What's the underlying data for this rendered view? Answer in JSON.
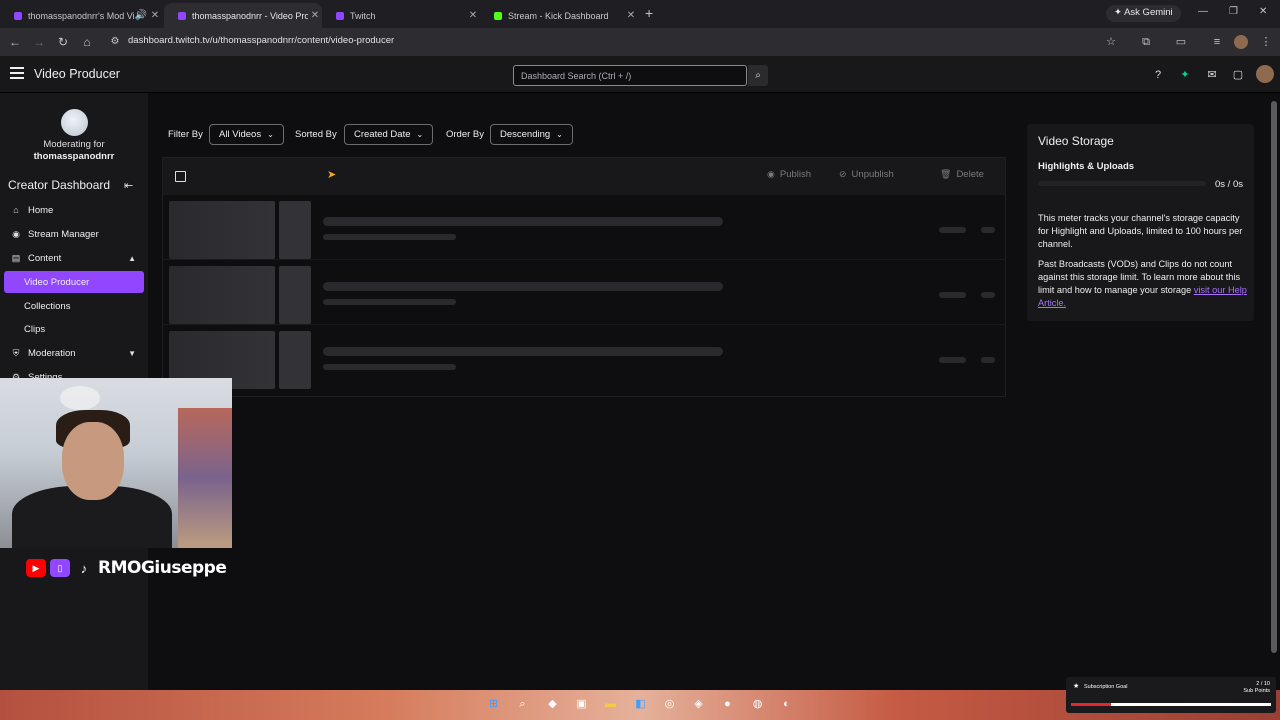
{
  "browser": {
    "tabs": [
      {
        "title": "thomasspanodnrr's Mod Vi",
        "favicon": "twitch-icon",
        "active": false
      },
      {
        "title": "thomasspanodnrr - Video Produ",
        "favicon": "twitch-icon",
        "active": true
      },
      {
        "title": "Twitch",
        "favicon": "twitch-icon",
        "active": false
      },
      {
        "title": "Stream - Kick Dashboard",
        "favicon": "kick-icon",
        "active": false
      }
    ],
    "ask_gemini": "Ask Gemini",
    "url": "dashboard.twitch.tv/u/thomasspanodnrr/content/video-producer"
  },
  "topnav": {
    "title": "Video Producer",
    "search_placeholder": "Dashboard Search (Ctrl + /)"
  },
  "sidebar": {
    "moderating_label": "Moderating for",
    "channel_name": "thomasspanodnrr",
    "section_title": "Creator Dashboard",
    "items": [
      {
        "label": "Home",
        "icon": "home-icon"
      },
      {
        "label": "Stream Manager",
        "icon": "stream-icon"
      },
      {
        "label": "Content",
        "icon": "content-icon",
        "expanded": true
      },
      {
        "label": "Video Producer",
        "active": true
      },
      {
        "label": "Collections"
      },
      {
        "label": "Clips"
      },
      {
        "label": "Moderation",
        "icon": "shield-icon",
        "expanded": false
      },
      {
        "label": "Settings",
        "icon": "gear-icon"
      }
    ]
  },
  "filters": {
    "filter_by_label": "Filter By",
    "filter_by_value": "All Videos",
    "sorted_by_label": "Sorted By",
    "sorted_by_value": "Created Date",
    "order_by_label": "Order By",
    "order_by_value": "Descending"
  },
  "list_header": {
    "publish": "Publish",
    "unpublish": "Unpublish",
    "delete": "Delete"
  },
  "storage": {
    "title": "Video Storage",
    "subtitle": "Highlights & Uploads",
    "count": "0s / 0s",
    "used_fraction": 0,
    "p1": "This meter tracks your channel's storage capacity for Highlight and Uploads, limited to 100 hours per channel.",
    "p2": "Past Broadcasts (VODs) and Clips do not count against this storage limit. To learn more about this limit and how to manage your storage ",
    "link": "visit our Help Article."
  },
  "overlay": {
    "social_name": "RMOGiuseppe",
    "sub_goal_label": "Subscription Goal",
    "sub_goal_count": "2 / 10",
    "sub_goal_unit": "Sub Points",
    "sub_goal_fraction": 0.2
  },
  "colors": {
    "accent": "#9147ff",
    "link": "#a970ff"
  }
}
